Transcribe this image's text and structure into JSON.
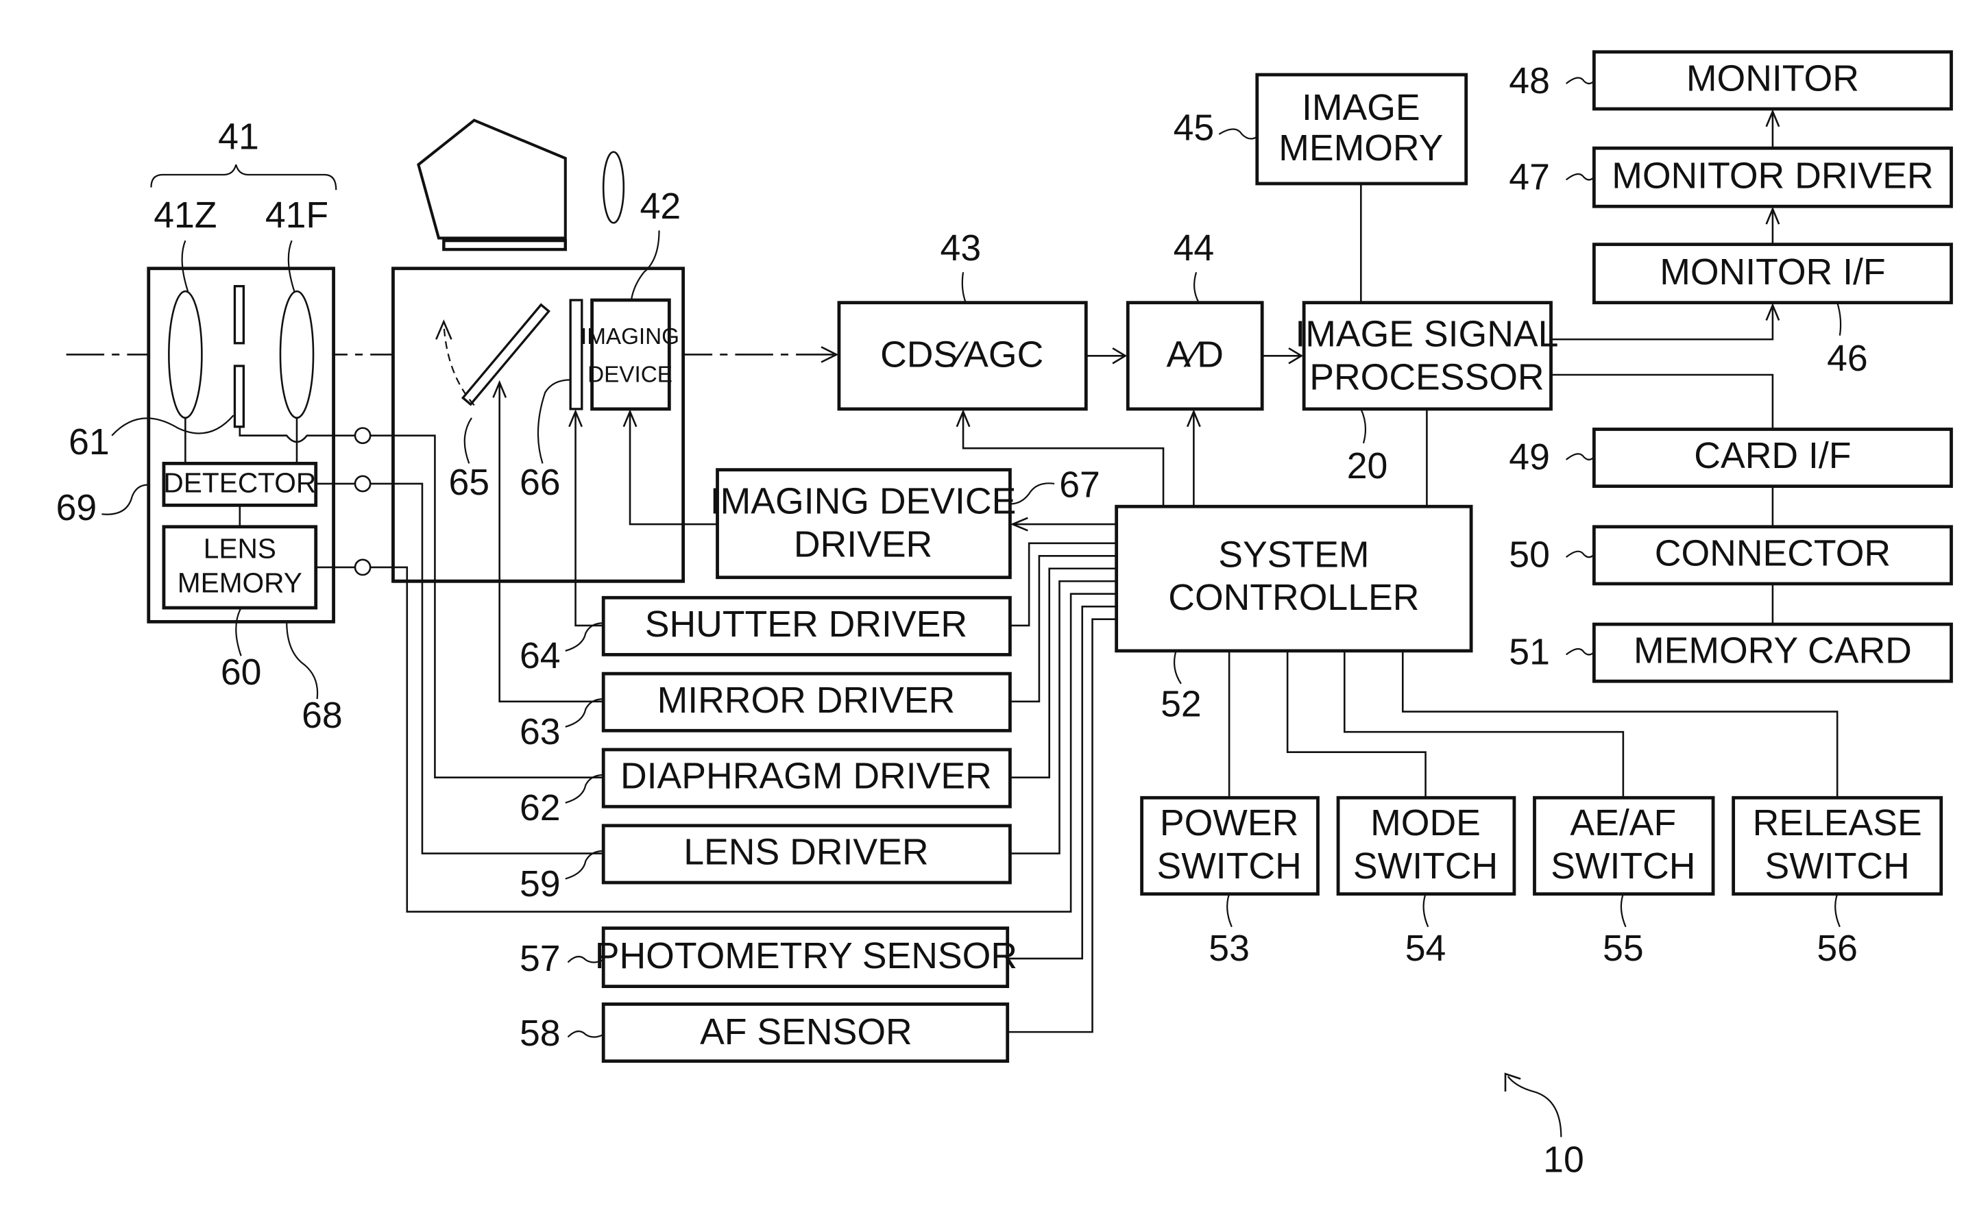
{
  "figure": {
    "ref": "10",
    "blocks": {
      "image_memory": {
        "ref": "45",
        "line1": "IMAGE",
        "line2": "MEMORY"
      },
      "monitor": {
        "ref": "48",
        "label": "MONITOR"
      },
      "monitor_driver": {
        "ref": "47",
        "label": "MONITOR DRIVER"
      },
      "monitor_if": {
        "ref": "46",
        "label": "MONITOR I/F"
      },
      "cds_agc": {
        "ref": "43",
        "label": "CDS∕AGC"
      },
      "a_d": {
        "ref": "44",
        "label": "A∕D"
      },
      "image_signal_processor": {
        "ref": "20",
        "line1": "IMAGE SIGNAL",
        "line2": "PROCESSOR"
      },
      "card_if": {
        "ref": "49",
        "label": "CARD I/F"
      },
      "connector": {
        "ref": "50",
        "label": "CONNECTOR"
      },
      "memory_card": {
        "ref": "51",
        "label": "MEMORY CARD"
      },
      "system_controller": {
        "ref": "52",
        "line1": "SYSTEM",
        "line2": "CONTROLLER"
      },
      "imaging_device": {
        "ref": "42",
        "line1": "IMAGING",
        "line2": "DEVICE"
      },
      "imaging_device_driver": {
        "ref": "67",
        "line1": "IMAGING DEVICE",
        "line2": "DRIVER"
      },
      "shutter_driver": {
        "ref": "64",
        "label": "SHUTTER DRIVER"
      },
      "mirror_driver": {
        "ref": "63",
        "label": "MIRROR DRIVER"
      },
      "diaphragm_driver": {
        "ref": "62",
        "label": "DIAPHRAGM DRIVER"
      },
      "lens_driver": {
        "ref": "59",
        "label": "LENS DRIVER"
      },
      "photometry_sensor": {
        "ref": "57",
        "label": "PHOTOMETRY SENSOR"
      },
      "af_sensor": {
        "ref": "58",
        "label": "AF SENSOR"
      },
      "detector": {
        "ref": "69",
        "label": "DETECTOR"
      },
      "lens_memory": {
        "ref": "60",
        "line1": "LENS",
        "line2": "MEMORY"
      },
      "power_switch": {
        "ref": "53",
        "line1": "POWER",
        "line2": "SWITCH"
      },
      "mode_switch": {
        "ref": "54",
        "line1": "MODE",
        "line2": "SWITCH"
      },
      "ae_af_switch": {
        "ref": "55",
        "line1": "AE/AF",
        "line2": "SWITCH"
      },
      "release_switch": {
        "ref": "56",
        "line1": "RELEASE",
        "line2": "SWITCH"
      }
    },
    "optics": {
      "lens_unit_ref": "41",
      "zoom_lens_ref": "41Z",
      "focus_lens_ref": "41F",
      "diaphragm_ref": "61",
      "lens_barrel_ref": "68",
      "mirror_ref": "65",
      "shutter_ref": "66"
    }
  }
}
